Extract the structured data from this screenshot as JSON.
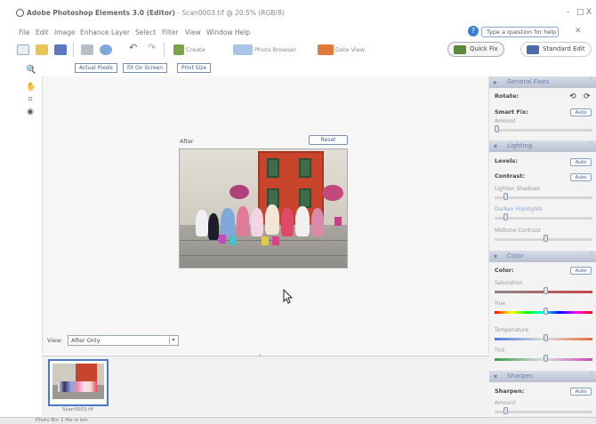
{
  "window": {
    "app_title": "Adobe Photoshop Elements 3.0 (Editor)",
    "doc_title": "- Scan0003.tif @ 20.5% (RGB/8)",
    "controls": [
      "-",
      "□",
      "X"
    ]
  },
  "menu": [
    "File",
    "Edit",
    "Image",
    "Enhance",
    "Layer",
    "Select",
    "Filter",
    "View",
    "Window",
    "Help"
  ],
  "help": {
    "placeholder": "Type a question for help"
  },
  "toolbar": {
    "create_label": "Create",
    "photo_browser_label": "Photo Browser",
    "date_view_label": "Date View",
    "quick_fix_label": "Quick Fix",
    "standard_edit_label": "Standard Edit"
  },
  "options": {
    "actual_pixels": "Actual Pixels",
    "fit_on_screen": "Fit On Screen",
    "print_size": "Print Size"
  },
  "canvas": {
    "after_label": "After",
    "reset_label": "Reset"
  },
  "view": {
    "label": "View:",
    "value": "After Only"
  },
  "bin": {
    "caption": "Scan0003.tif"
  },
  "status": {
    "text": "Photo Bin    1 file in bin"
  },
  "palette": {
    "general_fixes": {
      "title": "General Fixes",
      "rotate_label": "Rotate:",
      "smart_fix_label": "Smart Fix:",
      "auto_label": "Auto",
      "amount_label": "Amount"
    },
    "lighting": {
      "title": "Lighting",
      "levels_label": "Levels:",
      "contrast_label": "Contrast:",
      "auto_label": "Auto",
      "lighten_shadows": "Lighten Shadows",
      "darken_highlights": "Darken Highlights",
      "midtone_contrast": "Midtone Contrast"
    },
    "color": {
      "title": "Color",
      "color_label": "Color:",
      "auto_label": "Auto",
      "saturation": "Saturation",
      "hue": "Hue",
      "temperature": "Temperature",
      "tint": "Tint"
    },
    "sharpen": {
      "title": "Sharpen",
      "sharpen_label": "Sharpen:",
      "auto_label": "Auto",
      "amount_label": "Amount"
    }
  },
  "colors": {
    "accent_blue": "#4a78c2",
    "header_grad_top": "#d8dde8",
    "header_grad_bottom": "#b8c0d2",
    "door_red": "#c8442b"
  },
  "icons": {
    "tools": [
      "zoom-icon",
      "hand-icon",
      "crop-icon",
      "red-eye-icon"
    ],
    "toolbar": [
      "new-icon",
      "open-icon",
      "save-icon",
      "print-icon",
      "email-icon",
      "undo-icon",
      "redo-icon"
    ]
  }
}
